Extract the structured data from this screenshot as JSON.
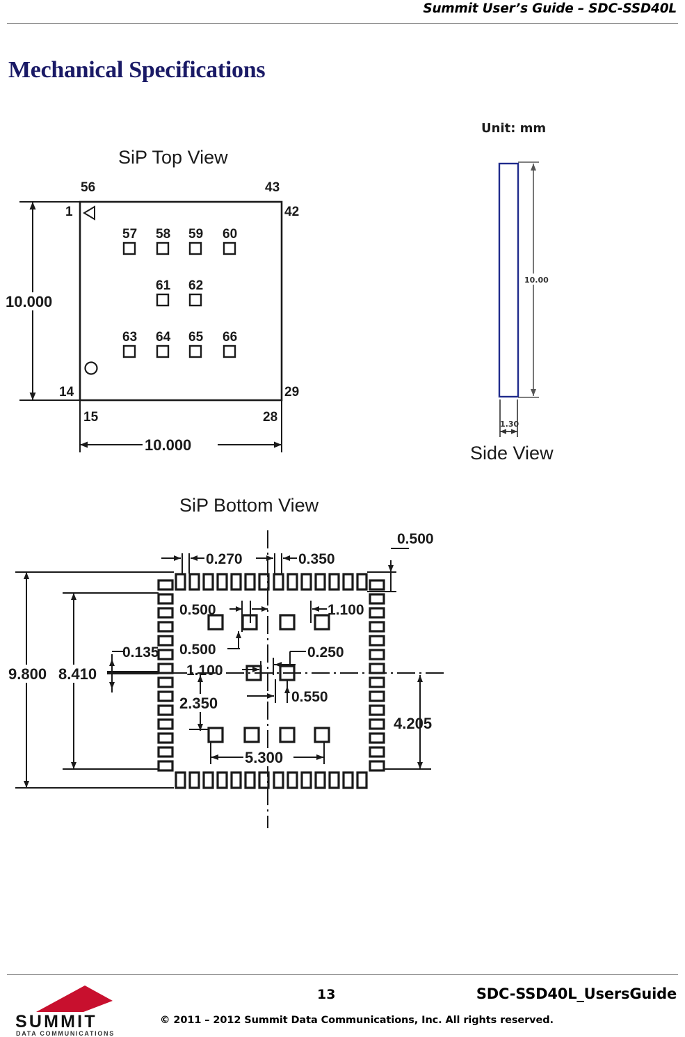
{
  "header": {
    "title": "Summit User’s Guide – SDC-SSD40L"
  },
  "section": {
    "heading": "Mechanical Specifications",
    "heading_color": "#1a1a66"
  },
  "figure": {
    "unit_label": "Unit: mm",
    "top_view": {
      "title": "SiP Top View",
      "width_dimension": "10.000",
      "height_dimension": "10.000",
      "corner_pins": {
        "top_left_outer": "56",
        "top_right_outer": "43",
        "left_top_inner": "1",
        "right_top_inner": "42",
        "left_bottom_inner": "14",
        "right_bottom_inner": "29",
        "bottom_left_outer": "15",
        "bottom_right_outer": "28"
      },
      "pad_rows": [
        {
          "labels": [
            "57",
            "58",
            "59",
            "60"
          ]
        },
        {
          "labels": [
            "61",
            "62"
          ]
        },
        {
          "labels": [
            "63",
            "64",
            "65",
            "66"
          ]
        }
      ]
    },
    "side_view": {
      "title": "Side View",
      "height_dimension": "10.00",
      "thickness_dimension": "1.30",
      "outline_color": "#1f2b8c"
    },
    "bottom_view": {
      "title": "SiP Bottom View",
      "dimensions": {
        "pad_width_top": "0.270",
        "pad_pitch_top": "0.350",
        "pad_offset_right": "0.500",
        "inner_pad_left": "0.500",
        "inner_pad_right": "1.100",
        "inner_pad_lower": "0.500",
        "inner_pad_lower_span": "1.100",
        "center_pad_vert": "0.250",
        "center_pad_horiz": "0.550",
        "pad_thickness": "0.135",
        "overall_height": "9.800",
        "inner_height": "8.410",
        "mid_row_offset": "2.350",
        "right_height": "4.205",
        "bottom_span": "5.300"
      },
      "pad_counts": {
        "top_row": 14,
        "bottom_row": 14,
        "left_column": 14,
        "right_column": 14
      }
    }
  },
  "footer": {
    "page_number": "13",
    "document_name": "SDC-SSD40L_UsersGuide",
    "copyright": "© 2011 – 2012 Summit Data Communications, Inc. All rights reserved.",
    "logo": {
      "wordmark": "SUMMIT",
      "tagline": "DATA COMMUNICATIONS",
      "mark_color": "#c8102e"
    }
  }
}
